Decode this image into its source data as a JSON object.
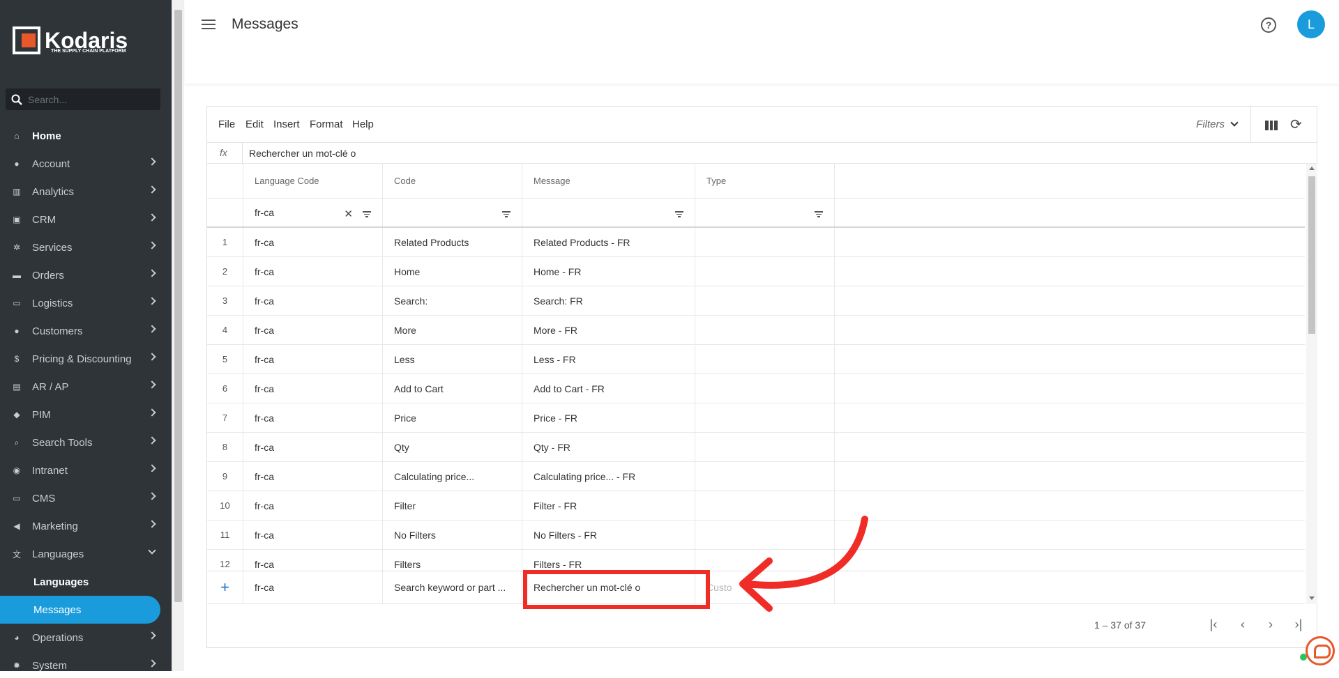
{
  "app": {
    "logo_text": "Kodaris",
    "logo_tagline": "THE SUPPLY CHAIN PLATFORM"
  },
  "sidebar": {
    "search_placeholder": "Search...",
    "items": [
      {
        "label": "Home",
        "icon": "home-icon"
      },
      {
        "label": "Account",
        "icon": "person-icon"
      },
      {
        "label": "Analytics",
        "icon": "chart-icon"
      },
      {
        "label": "CRM",
        "icon": "id-card-icon"
      },
      {
        "label": "Services",
        "icon": "gears-icon"
      },
      {
        "label": "Orders",
        "icon": "truck-icon"
      },
      {
        "label": "Logistics",
        "icon": "logistics-truck-icon"
      },
      {
        "label": "Customers",
        "icon": "group-icon"
      },
      {
        "label": "Pricing & Discounting",
        "icon": "dollar-icon"
      },
      {
        "label": "AR / AP",
        "icon": "bank-icon"
      },
      {
        "label": "PIM",
        "icon": "tag-icon"
      },
      {
        "label": "Search Tools",
        "icon": "search-icon"
      },
      {
        "label": "Intranet",
        "icon": "globe-icon"
      },
      {
        "label": "CMS",
        "icon": "browser-icon"
      },
      {
        "label": "Marketing",
        "icon": "megaphone-icon"
      },
      {
        "label": "Languages",
        "icon": "translate-icon"
      },
      {
        "label": "Operations",
        "icon": "operations-icon"
      },
      {
        "label": "System",
        "icon": "gear-icon"
      }
    ],
    "sub_items": [
      {
        "label": "Languages"
      },
      {
        "label": "Messages"
      }
    ]
  },
  "header": {
    "title": "Messages",
    "avatar_initial": "L"
  },
  "toolbar": {
    "menu": [
      "File",
      "Edit",
      "Insert",
      "Format",
      "Help"
    ],
    "filters_label": "Filters"
  },
  "formula_bar": {
    "label": "fx",
    "value": "Rechercher un mot-clé o"
  },
  "table": {
    "columns": [
      "Language Code",
      "Code",
      "Message",
      "Type"
    ],
    "filter_values": [
      "fr-ca",
      "",
      "",
      ""
    ],
    "rows": [
      {
        "n": "1",
        "lang": "fr-ca",
        "code": "Related Products",
        "message": "Related Products - FR",
        "type": ""
      },
      {
        "n": "2",
        "lang": "fr-ca",
        "code": "Home",
        "message": "Home - FR",
        "type": ""
      },
      {
        "n": "3",
        "lang": "fr-ca",
        "code": "Search:",
        "message": "Search: FR",
        "type": ""
      },
      {
        "n": "4",
        "lang": "fr-ca",
        "code": "More",
        "message": "More - FR",
        "type": ""
      },
      {
        "n": "5",
        "lang": "fr-ca",
        "code": "Less",
        "message": "Less - FR",
        "type": ""
      },
      {
        "n": "6",
        "lang": "fr-ca",
        "code": "Add to Cart",
        "message": "Add to Cart - FR",
        "type": ""
      },
      {
        "n": "7",
        "lang": "fr-ca",
        "code": "Price",
        "message": "Price - FR",
        "type": ""
      },
      {
        "n": "8",
        "lang": "fr-ca",
        "code": "Qty",
        "message": "Qty - FR",
        "type": ""
      },
      {
        "n": "9",
        "lang": "fr-ca",
        "code": "Calculating price...",
        "message": "Calculating price... - FR",
        "type": ""
      },
      {
        "n": "10",
        "lang": "fr-ca",
        "code": "Filter",
        "message": "Filter - FR",
        "type": ""
      },
      {
        "n": "11",
        "lang": "fr-ca",
        "code": "No Filters",
        "message": "No Filters - FR",
        "type": ""
      },
      {
        "n": "12",
        "lang": "fr-ca",
        "code": "Filters",
        "message": "Filters - FR",
        "type": ""
      }
    ],
    "new_row": {
      "lang": "fr-ca",
      "code": "Search keyword or part ...",
      "message": "Rechercher un mot-clé o",
      "type_placeholder": "Custo"
    }
  },
  "pager": {
    "range_text": "1 – 37 of 37"
  },
  "colors": {
    "sidebar_bg": "#2f3439",
    "accent": "#1a9bdc",
    "highlight": "#f02c27",
    "brand_orange": "#e8582a"
  }
}
